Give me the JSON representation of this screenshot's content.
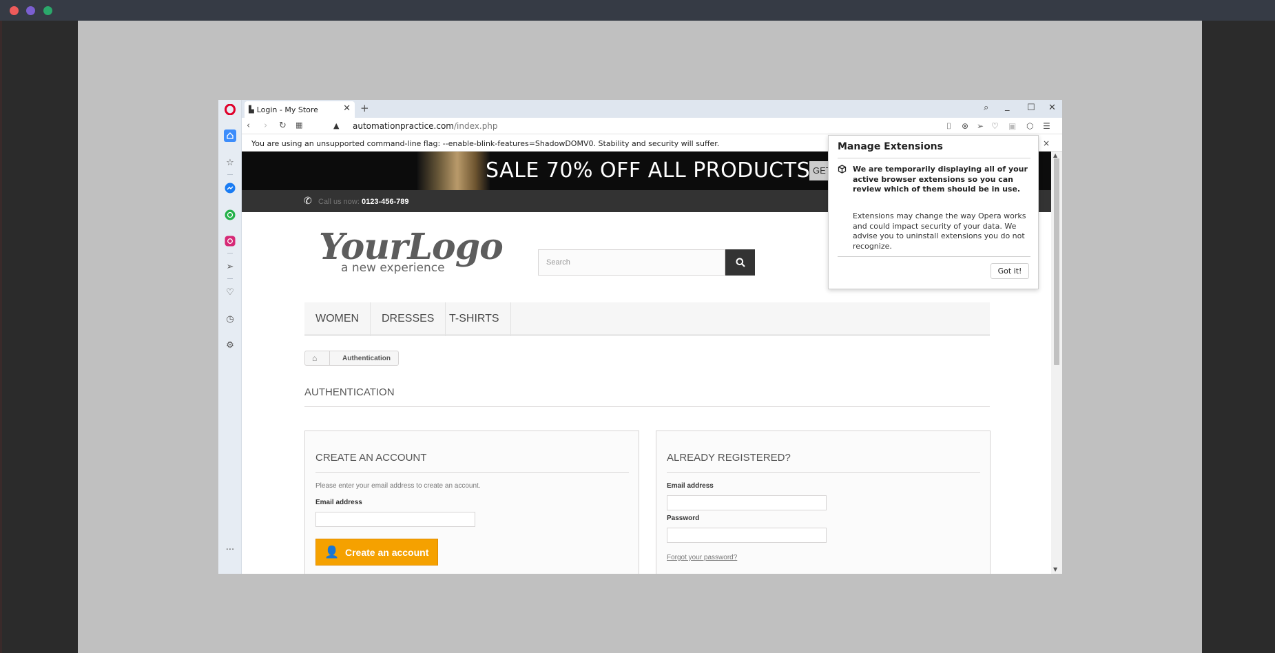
{
  "browser": {
    "tab_title": "Login - My Store",
    "url_host": "automationpractice.com",
    "url_path": "/index.php",
    "infobar_text": "You are using an unsupported command-line flag: --enable-blink-features=ShadowDOMV0. Stability and security will suffer.",
    "infobar_close": "×",
    "tab_close": "✕",
    "new_tab": "+"
  },
  "extensions_popup": {
    "title": "Manage Extensions",
    "bold_text": "We are temporarily displaying all of your active browser extensions so you can review which of them should be in use.",
    "body_text": "Extensions may change the way Opera works and could impact security of your data. We advise you to uninstall extensions you do not recognize.",
    "button": "Got it!"
  },
  "site": {
    "banner_text": "SALE 70% OFF ALL PRODUCTS",
    "banner_button": "GET",
    "call_label": "Call us now:",
    "call_number": "0123-456-789",
    "logo_main": "YourLogo",
    "logo_sub": "a new experience",
    "search_placeholder": "Search",
    "menu": [
      "WOMEN",
      "DRESSES",
      "T-SHIRTS"
    ],
    "breadcrumb": "Authentication",
    "page_heading": "AUTHENTICATION",
    "create": {
      "title": "CREATE AN ACCOUNT",
      "text": "Please enter your email address to create an account.",
      "email_label": "Email address",
      "button": "Create an account"
    },
    "login": {
      "title": "ALREADY REGISTERED?",
      "email_label": "Email address",
      "password_label": "Password",
      "forgot": "Forgot your password?"
    }
  },
  "colors": {
    "accent_orange": "#f5a100",
    "opera_red": "#e0002a",
    "sidebar_active": "#3d8dfb"
  }
}
